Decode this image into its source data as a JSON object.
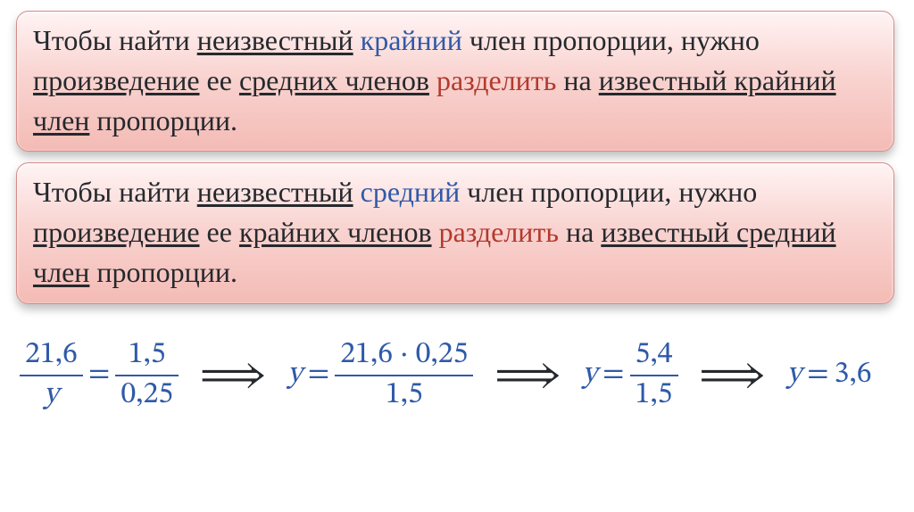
{
  "rules": [
    {
      "parts": [
        {
          "t": "Чтобы найти "
        },
        {
          "t": "неизвестный",
          "u": true
        },
        {
          "t": " "
        },
        {
          "t": "крайний",
          "cls": "kw-ext"
        },
        {
          "t": " член пропорции, нужно "
        },
        {
          "t": "произведение",
          "u": true
        },
        {
          "t": " ее "
        },
        {
          "t": "средних членов",
          "u": true
        },
        {
          "t": " "
        },
        {
          "t": "разделить",
          "cls": "kw-div"
        },
        {
          "t": " на "
        },
        {
          "t": "известный крайний член",
          "u": true
        },
        {
          "t": " пропорции."
        }
      ]
    },
    {
      "parts": [
        {
          "t": "Чтобы найти "
        },
        {
          "t": "неизвестный",
          "u": true
        },
        {
          "t": " "
        },
        {
          "t": "средний",
          "cls": "kw-mid"
        },
        {
          "t": " член пропорции, нужно "
        },
        {
          "t": "произведение",
          "u": true
        },
        {
          "t": " ее "
        },
        {
          "t": "крайних членов",
          "u": true
        },
        {
          "t": " "
        },
        {
          "t": "разделить",
          "cls": "kw-div"
        },
        {
          "t": " на "
        },
        {
          "t": "известный средний член",
          "u": true
        },
        {
          "t": " пропорции."
        }
      ]
    }
  ],
  "math": {
    "step1": {
      "lhs_num": "21,6",
      "lhs_den": "y",
      "rhs_num": "1,5",
      "rhs_den": "0,25"
    },
    "step2": {
      "var": "y",
      "num": "21,6 · 0,25",
      "den": "1,5"
    },
    "step3": {
      "var": "y",
      "num": "5,4",
      "den": "1,5"
    },
    "step4": {
      "var": "y",
      "val": "3,6"
    }
  },
  "glyphs": {
    "arrow": "⟹",
    "eq": "="
  }
}
